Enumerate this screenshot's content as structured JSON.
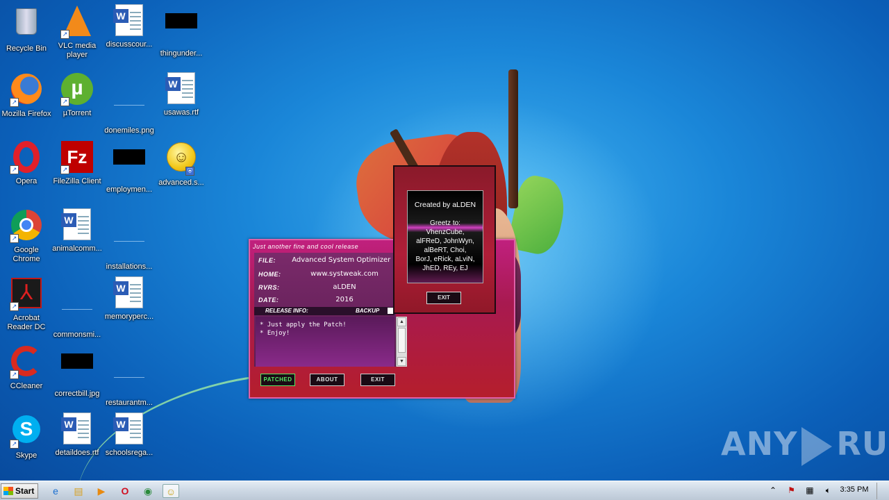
{
  "desktop": {
    "icons": [
      {
        "label": "Recycle Bin"
      },
      {
        "label": "VLC media player"
      },
      {
        "label": "discusscour..."
      },
      {
        "label": "thingunder..."
      },
      {
        "label": "Mozilla Firefox"
      },
      {
        "label": "µTorrent"
      },
      {
        "label": "donemiles.png"
      },
      {
        "label": "usawas.rtf"
      },
      {
        "label": "Opera"
      },
      {
        "label": "FileZilla Client"
      },
      {
        "label": "employmen..."
      },
      {
        "label": "advanced.s..."
      },
      {
        "label": "Google Chrome"
      },
      {
        "label": "animalcomm..."
      },
      {
        "label": "installations..."
      },
      {
        "label": "Acrobat Reader DC"
      },
      {
        "label": "commonsmi..."
      },
      {
        "label": "memoryperc..."
      },
      {
        "label": "CCleaner"
      },
      {
        "label": "correctbill.jpg"
      },
      {
        "label": "restaurantm..."
      },
      {
        "label": "Skype"
      },
      {
        "label": "detaildoes.rtf"
      },
      {
        "label": "schoolsrega..."
      }
    ]
  },
  "patcher": {
    "title": "Just another fine and cool release",
    "file_key": "FILE:",
    "file_val": "Advanced System Optimizer 3",
    "home_key": "HOME:",
    "home_val": "www.systweak.com",
    "rvrs_key": "RVRS:",
    "rvrs_val": "aLDEN",
    "date_key": "DATE:",
    "date_val": "2016",
    "release_info": "RELEASE INFO:",
    "backup": "BACKUP",
    "notes": [
      "* Just apply the Patch!",
      "* Enjoy!"
    ],
    "btn_patched": "PATCHED",
    "btn_about": "ABOUT",
    "btn_exit": "EXIT"
  },
  "about": {
    "created": "Created by aLDEN",
    "greetz": [
      "Greetz to:",
      "VhenzCube,",
      "alFReD, JohnWyn,",
      "alBeRT, Choi,",
      "BorJ, eRick, aLviN,",
      "JhED, REy, EJ"
    ],
    "exit": "EXIT"
  },
  "watermark": {
    "left": "ANY",
    "right": "RUN"
  },
  "taskbar": {
    "start": "Start",
    "clock": "3:35 PM",
    "apps": [
      "internet-explorer-icon",
      "explorer-icon",
      "media-player-icon",
      "opera-icon",
      "chrome-icon",
      "smiley-icon"
    ]
  },
  "colors": {
    "patch_bg": "#b51e2c",
    "accent_pink": "#c0207e",
    "patched_green": "#55ee66"
  }
}
